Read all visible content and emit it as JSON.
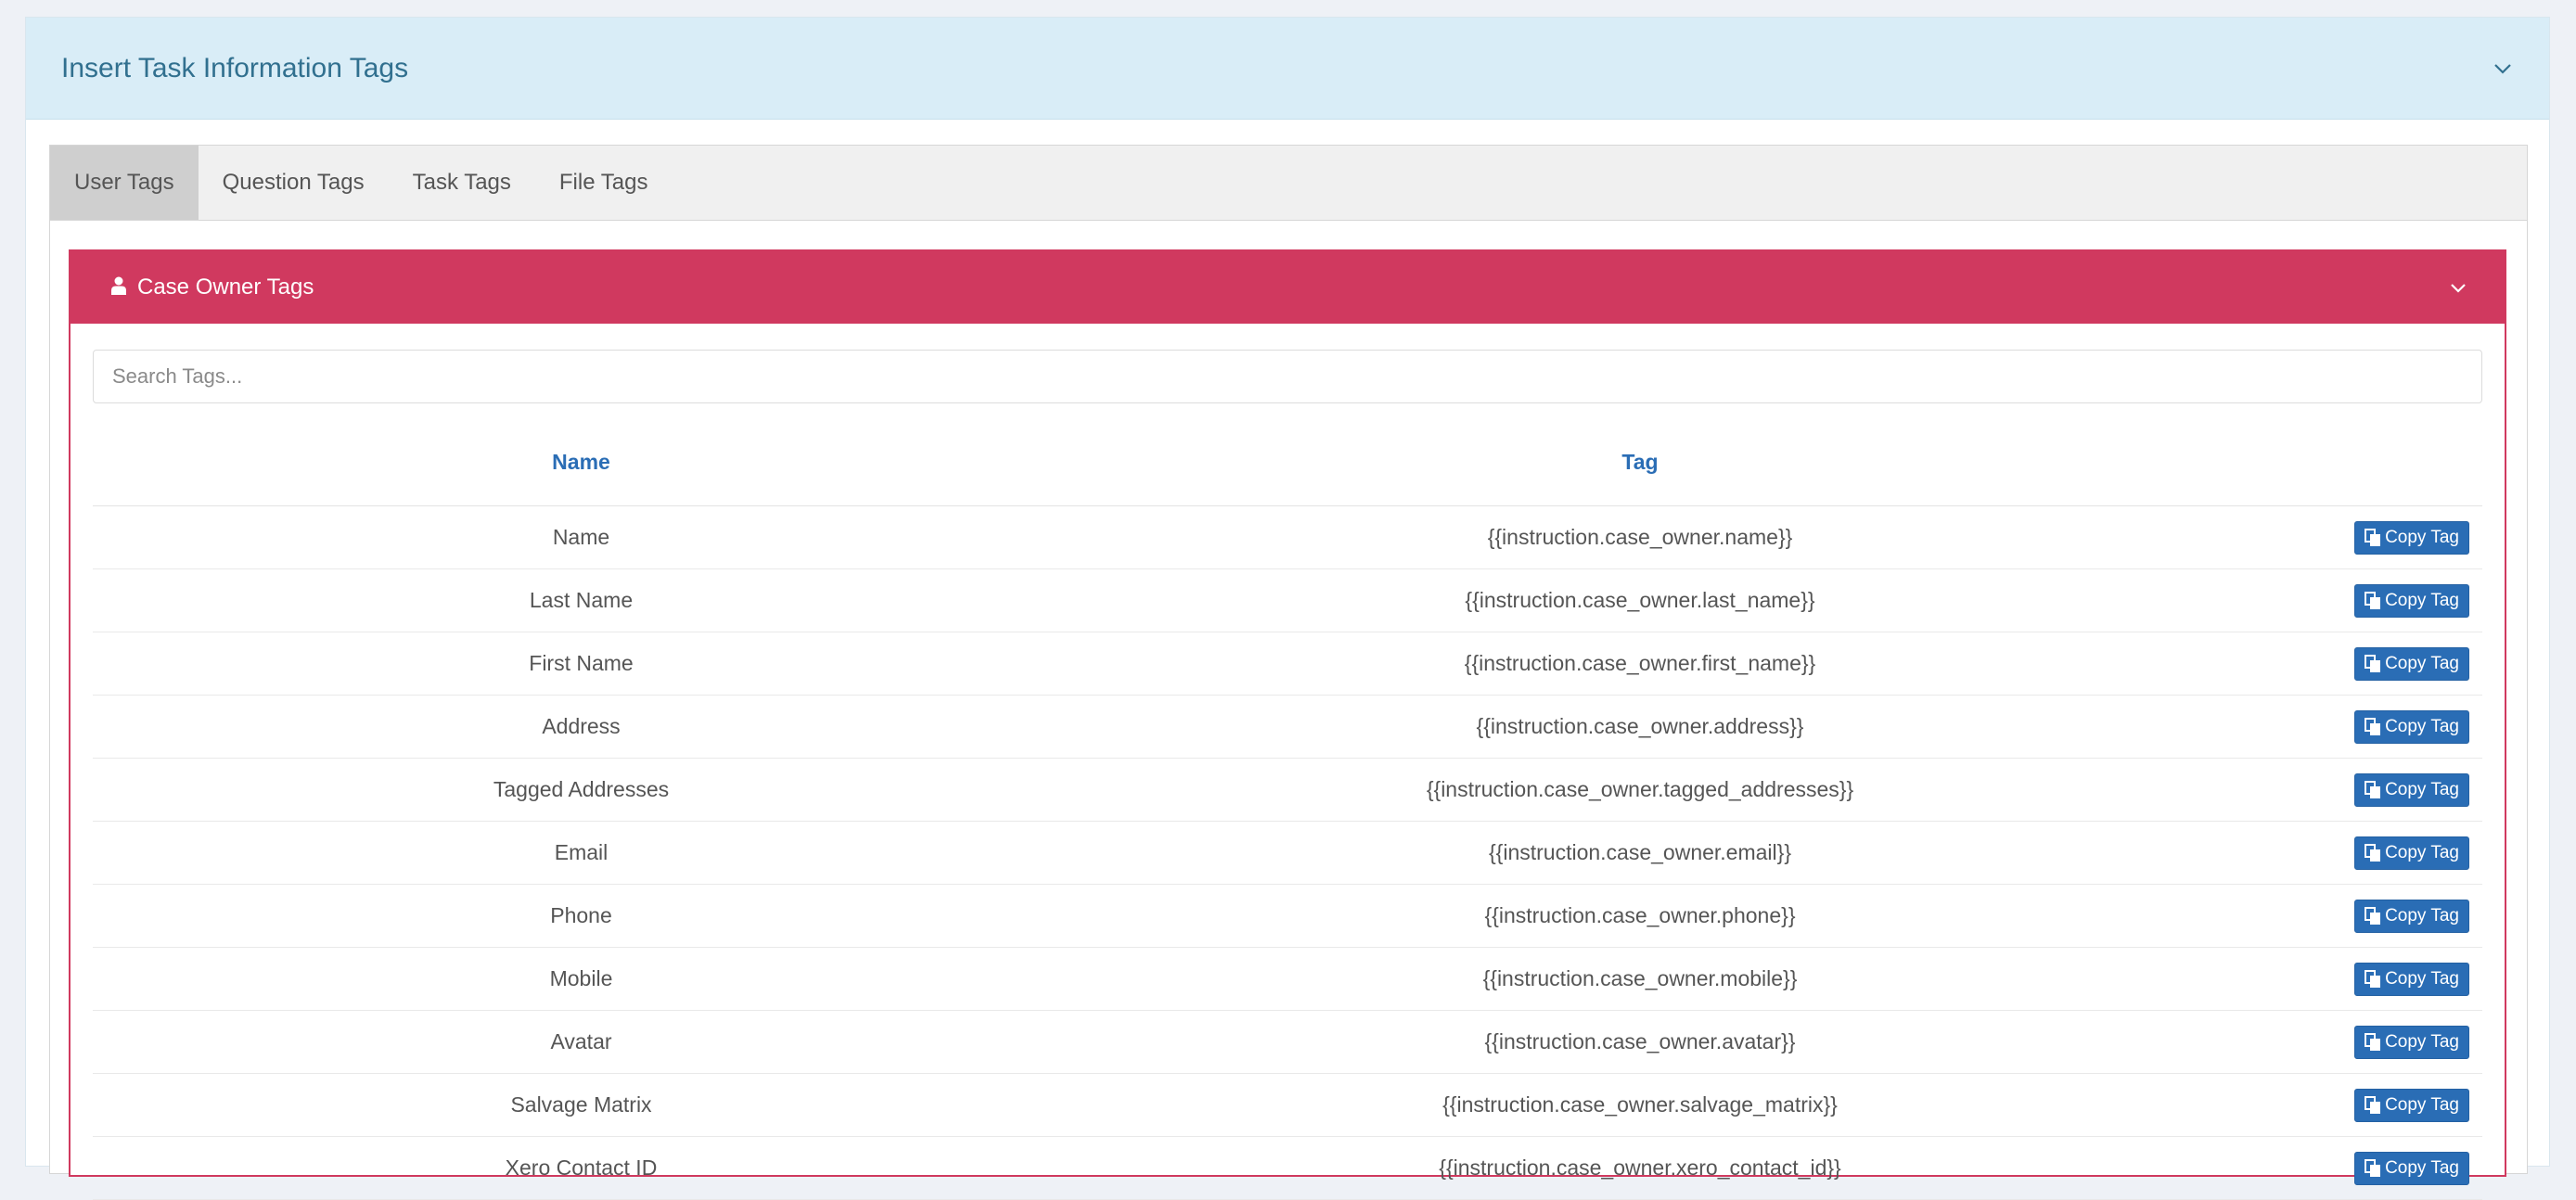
{
  "outer_panel": {
    "title": "Insert Task Information Tags",
    "toggle_icon": "chevron-down-icon"
  },
  "tabs": [
    {
      "label": "User Tags",
      "active": true
    },
    {
      "label": "Question Tags",
      "active": false
    },
    {
      "label": "Task Tags",
      "active": false
    },
    {
      "label": "File Tags",
      "active": false
    }
  ],
  "inner_panel": {
    "title": "Case Owner Tags",
    "title_icon": "user-icon",
    "toggle_icon": "chevron-down-icon",
    "accent_color": "#d0395f"
  },
  "search": {
    "placeholder": "Search Tags...",
    "value": ""
  },
  "table": {
    "headers": {
      "name": "Name",
      "tag": "Tag"
    },
    "copy_label": "Copy Tag",
    "copy_icon": "copy-icon",
    "rows": [
      {
        "name": "Name",
        "tag": "{{instruction.case_owner.name}}"
      },
      {
        "name": "Last Name",
        "tag": "{{instruction.case_owner.last_name}}"
      },
      {
        "name": "First Name",
        "tag": "{{instruction.case_owner.first_name}}"
      },
      {
        "name": "Address",
        "tag": "{{instruction.case_owner.address}}"
      },
      {
        "name": "Tagged Addresses",
        "tag": "{{instruction.case_owner.tagged_addresses}}"
      },
      {
        "name": "Email",
        "tag": "{{instruction.case_owner.email}}"
      },
      {
        "name": "Phone",
        "tag": "{{instruction.case_owner.phone}}"
      },
      {
        "name": "Mobile",
        "tag": "{{instruction.case_owner.mobile}}"
      },
      {
        "name": "Avatar",
        "tag": "{{instruction.case_owner.avatar}}"
      },
      {
        "name": "Salvage Matrix",
        "tag": "{{instruction.case_owner.salvage_matrix}}"
      },
      {
        "name": "Xero Contact ID",
        "tag": "{{instruction.case_owner.xero_contact_id}}"
      }
    ]
  }
}
